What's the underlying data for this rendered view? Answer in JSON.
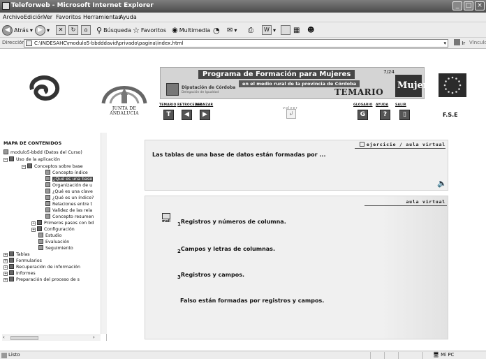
{
  "window": {
    "title": "Teleforweb - Microsoft Internet Explorer"
  },
  "menu": [
    "Archivo",
    "Edición",
    "Ver",
    "Favoritos",
    "Herramientas",
    "Ayuda"
  ],
  "toolbar": {
    "back_label": "Atrás",
    "search_label": "Búsqueda",
    "favorites_label": "Favoritos",
    "multimedia_label": "Multimedia"
  },
  "address": {
    "label": "Dirección",
    "url": "C:\\INDESAHC\\modulo5-bbdddavid\\privado\\pagina\\index.html",
    "go_label": "Ir",
    "links_label": "Vínculos"
  },
  "header": {
    "junta_label": "JUNTA DE ANDALUCIA",
    "program_title": "Programa de Formación para Mujeres",
    "program_subtitle": "en el medio rural de la provincia de Córdoba",
    "diputacion_name": "Diputación de Córdoba",
    "diputacion_sub": "Delegación de Igualdad",
    "temario": "TEMARIO",
    "page_number": "7/24",
    "mujer_label": "Mujer",
    "fse_label": "F.S.E"
  },
  "nav": {
    "temario": "TEMARIO",
    "retroceder": "RETROCEDER",
    "avanzar": "AVANZAR",
    "volver": "volver",
    "glosario": "GLOSARIO",
    "ayuda": "AYUDA",
    "salir": "SALIR"
  },
  "tree": {
    "title": "MAPA DE CONTENIDOS",
    "items": [
      "modulo5-bbdd (Datos del Curso)",
      "Uso de la aplicación",
      "Conceptos sobre base",
      "Concepto índice",
      "¿Qué es una base",
      "Organización de u",
      "¿Qué es una clave",
      "¿Qué es un índice?",
      "Relaciones entre t",
      "Validez de las rela",
      "Concepto resumen",
      "Primeros pasos con bd",
      "Configuración",
      "Estudio",
      "Evaluación",
      "Seguimiento",
      "Tablas",
      "Formularios",
      "Recuperación de información",
      "Informes",
      "Preparación del proceso de s"
    ]
  },
  "exercise": {
    "question": "Las tablas de una base de datos están formadas por ...",
    "ejercicio_label": "ejercicio / aula virtual",
    "aula_label": "aula virtual",
    "mail_label": "mail",
    "options": [
      {
        "num": "1",
        "text": "Registros y números de columna."
      },
      {
        "num": "2",
        "text": "Campos y letras de columnas."
      },
      {
        "num": "3",
        "text": "Registros y campos."
      }
    ],
    "feedback": "Falso están formadas por registros y campos."
  },
  "status": {
    "text": "Listo",
    "zone": "Mi PC"
  }
}
